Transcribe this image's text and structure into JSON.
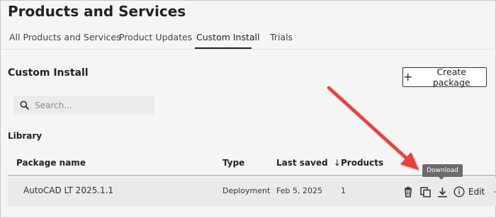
{
  "page": {
    "title": "Products and Services"
  },
  "tabs": [
    {
      "label": "All Products and Services",
      "active": false
    },
    {
      "label": "Product Updates",
      "active": false
    },
    {
      "label": "Custom Install",
      "active": true
    },
    {
      "label": "Trials",
      "active": false
    }
  ],
  "section": {
    "title": "Custom Install",
    "create_button_label": "Create package"
  },
  "search": {
    "placeholder": "Search..."
  },
  "library": {
    "label": "Library",
    "columns": [
      {
        "label": "Package name"
      },
      {
        "label": "Type"
      },
      {
        "label": "Last saved",
        "sort": "↓"
      },
      {
        "label": "Products"
      }
    ],
    "rows": [
      {
        "name": "AutoCAD LT 2025.1.1",
        "type": "Deployment",
        "last_saved": "Feb 5, 2025",
        "products": "1",
        "actions": {
          "delete_icon": "trash-icon",
          "copy_icon": "copy-icon",
          "download_icon": "download-icon",
          "info_icon": "info-icon",
          "edit_label": "Edit",
          "more_glyph": "→"
        }
      }
    ]
  },
  "tooltip": {
    "text": "Download"
  },
  "annotation": {
    "arrow_color": "#e8403a"
  }
}
